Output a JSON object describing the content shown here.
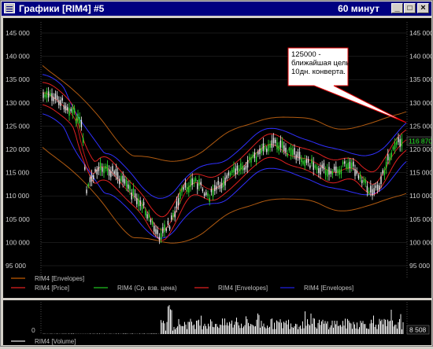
{
  "window": {
    "title": "Графики [RIM4] #5",
    "period": "60 минут",
    "buttons": {
      "minimize": "_",
      "maximize": "□",
      "close": "×"
    }
  },
  "chart": {
    "y_ticks": [
      "145 000",
      "140 000",
      "135 000",
      "130 000",
      "125 000",
      "120 000",
      "115 000",
      "110 000",
      "105 000",
      "100 000",
      "95 000"
    ],
    "current_price": "116 870",
    "annotation": "125000 -\nближайшая цель\n10дн. конверта.",
    "legend": [
      {
        "label": "RIM4 [Envelopes]",
        "color": "#c05a00"
      },
      {
        "label": "RIM4 [Price]",
        "color": "#e02020"
      },
      {
        "label": "RIM4 (Ср. взв. цена)",
        "color": "#20c020"
      },
      {
        "label": "RIM4 [Envelopes]",
        "color": "#e02020"
      },
      {
        "label": "RIM4 [Envelopes]",
        "color": "#2020e0"
      }
    ]
  },
  "volume": {
    "zero_label": "0",
    "last_value": "8 508",
    "legend": "RIM4 [Volume]"
  }
}
